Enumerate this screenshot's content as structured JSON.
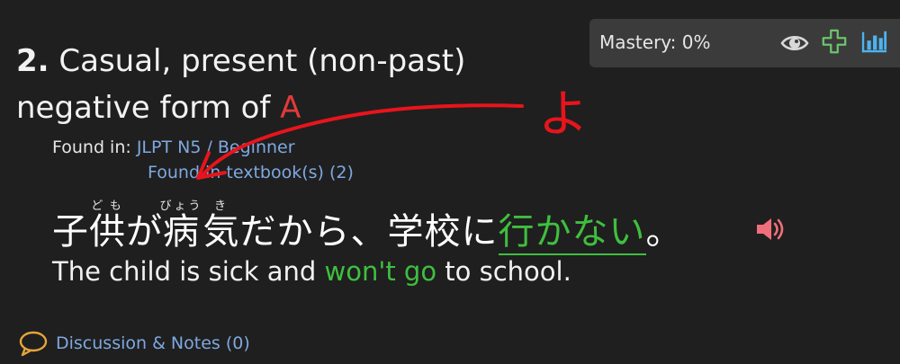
{
  "grammar": {
    "number": "2.",
    "title_part1": " Casual, present (non-past)",
    "title_part2": "negative form of ",
    "title_highlight": "A"
  },
  "mastery": {
    "label": "Mastery: 0%"
  },
  "found_in": {
    "label": "Found in: ",
    "level_link": "JLPT N5 / Beginner",
    "textbook_link": "Found in textbook(s) (2)"
  },
  "sentence": {
    "jp_kodomo": "子供",
    "jp_kodomo_ruby": "ども",
    "jp_ga": "が",
    "jp_byouki": "病気",
    "jp_byouki_ruby_1": "びょう",
    "jp_byouki_ruby_2": "き",
    "jp_middle": "だから、学校に",
    "jp_target": "行かない",
    "jp_end": "。",
    "en_before": "The child is sick and ",
    "en_target": "won't go",
    "en_after": " to school."
  },
  "discussion": {
    "label": "Discussion & Notes (0)"
  },
  "annotation": {
    "handwritten_text": "よ"
  },
  "colors": {
    "background": "#1f1f1f",
    "panel": "#3b3b3b",
    "highlight_red": "#e23a3a",
    "link_blue": "#7fa8e0",
    "target_green": "#3fbf3f",
    "annotation_red": "#e8141c"
  }
}
